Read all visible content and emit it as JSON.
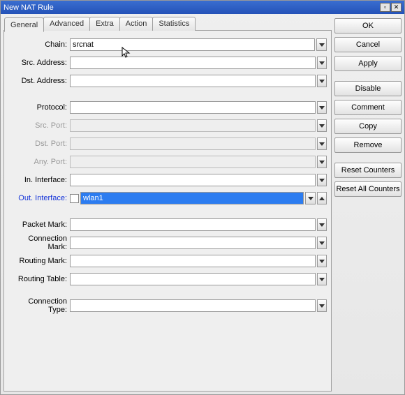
{
  "title": "New NAT Rule",
  "tabs": {
    "general": "General",
    "advanced": "Advanced",
    "extra": "Extra",
    "action": "Action",
    "statistics": "Statistics"
  },
  "labels": {
    "chain": "Chain:",
    "srcAddress": "Src. Address:",
    "dstAddress": "Dst. Address:",
    "protocol": "Protocol:",
    "srcPort": "Src. Port:",
    "dstPort": "Dst. Port:",
    "anyPort": "Any. Port:",
    "inInterface": "In. Interface:",
    "outInterface": "Out. Interface:",
    "packetMark": "Packet Mark:",
    "connectionMark": "Connection Mark:",
    "routingMark": "Routing Mark:",
    "routingTable": "Routing Table:",
    "connectionType": "Connection Type:"
  },
  "values": {
    "chain": "srcnat",
    "outInterface": "wlan1"
  },
  "buttons": {
    "ok": "OK",
    "cancel": "Cancel",
    "apply": "Apply",
    "disable": "Disable",
    "comment": "Comment",
    "copy": "Copy",
    "remove": "Remove",
    "resetCounters": "Reset Counters",
    "resetAllCounters": "Reset All Counters"
  }
}
